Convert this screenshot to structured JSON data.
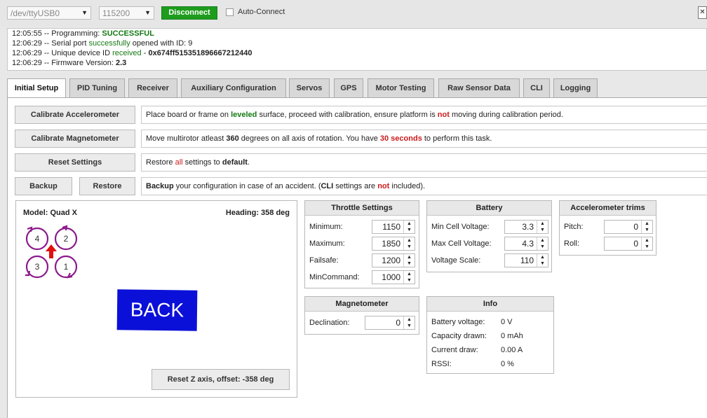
{
  "topbar": {
    "port": "/dev/ttyUSB0",
    "baud": "115200",
    "disconnect_label": "Disconnect",
    "autoconnect_label": "Auto-Connect"
  },
  "log": {
    "l1_time": "12:05:55 -- Programming: ",
    "l1_status": "SUCCESSFUL",
    "l2_pre": "12:06:29 -- Serial port ",
    "l2_green": "successfully",
    "l2_post": " opened with ID: 9",
    "l3_pre": "12:06:29 -- Unique device ID ",
    "l3_green": "received",
    "l3_dash": " - ",
    "l3_id": "0x674ff515351896667212440",
    "l4_pre": "12:06:29 -- Firmware Version: ",
    "l4_ver": "2.3"
  },
  "tabs": [
    "Initial Setup",
    "PID Tuning",
    "Receiver",
    "Auxiliary Configuration",
    "Servos",
    "GPS",
    "Motor Testing",
    "Raw Sensor Data",
    "CLI",
    "Logging"
  ],
  "calibrate_acc": {
    "button": "Calibrate Accelerometer",
    "t1": "Place board or frame on ",
    "t2": "leveled",
    "t3": " surface, proceed with calibration, ensure platform is ",
    "t4": "not",
    "t5": " moving during calibration period."
  },
  "calibrate_mag": {
    "button": "Calibrate Magnetometer",
    "t1": "Move multirotor atleast ",
    "t2": "360",
    "t3": " degrees on all axis of rotation. You have ",
    "t4": "30 seconds",
    "t5": " to perform this task."
  },
  "reset": {
    "button": "Reset Settings",
    "t1": "Restore ",
    "t2": "all",
    "t3": " settings to ",
    "t4": "default",
    "t5": "."
  },
  "backup": {
    "backup_button": "Backup",
    "restore_button": "Restore",
    "t1": "Backup",
    "t2": " your configuration in case of an accident. (",
    "t3": "CLI",
    "t4": " settings are ",
    "t5": "not",
    "t6": " included)."
  },
  "model": {
    "model_label": "Model: Quad X",
    "heading_label": "Heading: 358 deg",
    "motors": [
      "4",
      "2",
      "3",
      "1"
    ],
    "back_label": "BACK",
    "reset_z_label": "Reset Z axis, offset: -358 deg"
  },
  "throttle": {
    "title": "Throttle Settings",
    "fields": [
      {
        "label": "Minimum:",
        "value": "1150"
      },
      {
        "label": "Maximum:",
        "value": "1850"
      },
      {
        "label": "Failsafe:",
        "value": "1200"
      },
      {
        "label": "MinCommand:",
        "value": "1000"
      }
    ]
  },
  "battery": {
    "title": "Battery",
    "fields": [
      {
        "label": "Min Cell Voltage:",
        "value": "3.3"
      },
      {
        "label": "Max Cell Voltage:",
        "value": "4.3"
      },
      {
        "label": "Voltage Scale:",
        "value": "110"
      }
    ]
  },
  "acc_trims": {
    "title": "Accelerometer trims",
    "fields": [
      {
        "label": "Pitch:",
        "value": "0"
      },
      {
        "label": "Roll:",
        "value": "0"
      }
    ]
  },
  "magnetometer": {
    "title": "Magnetometer",
    "field": {
      "label": "Declination:",
      "value": "0"
    }
  },
  "info": {
    "title": "Info",
    "rows": [
      {
        "label": "Battery voltage:",
        "value": "0 V"
      },
      {
        "label": "Capacity drawn:",
        "value": "0 mAh"
      },
      {
        "label": "Current draw:",
        "value": "0.00 A"
      },
      {
        "label": "RSSI:",
        "value": "0 %"
      }
    ]
  },
  "colors": {
    "accent_green": "#1e9c1e",
    "warning_red": "#cc1b1b",
    "motor_purple": "#8b1a8b",
    "arrow_red": "#e01010",
    "back_blue": "#0b10d8"
  }
}
